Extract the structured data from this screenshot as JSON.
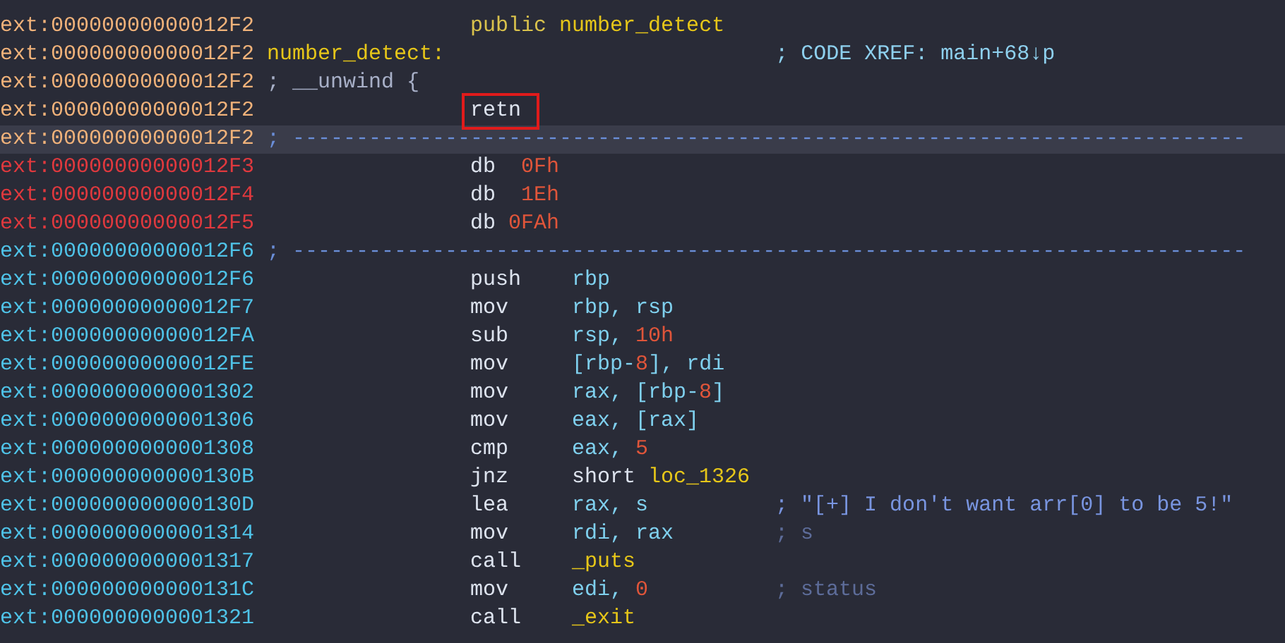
{
  "rows": [
    {
      "address": {
        "text": "ext:00000000000012F2",
        "color": "#f0b27a"
      },
      "kind": "directive",
      "selected": false,
      "tokens": [
        {
          "text": "public",
          "color": "#d9c24c"
        },
        {
          "text": "number_detect",
          "color": "#e6c619"
        }
      ]
    },
    {
      "address": {
        "text": "ext:00000000000012F2",
        "color": "#f0b27a"
      },
      "kind": "label",
      "selected": false,
      "label": "number_detect:",
      "comment": {
        "text": "; CODE XREF: main+68↓p",
        "color": "#8ed0ee"
      }
    },
    {
      "address": {
        "text": "ext:00000000000012F2",
        "color": "#f0b27a"
      },
      "kind": "note",
      "selected": false,
      "text": "; __unwind {"
    },
    {
      "address": {
        "text": "ext:00000000000012F2",
        "color": "#f0b27a"
      },
      "kind": "instruction",
      "selected": false,
      "mnemonic": "retn",
      "boxed": true,
      "tokens": []
    },
    {
      "address": {
        "text": "ext:00000000000012F2",
        "color": "#f0b27a"
      },
      "kind": "separator",
      "selected": true,
      "text": "; ---------------------------------------------------------------------------"
    },
    {
      "address": {
        "text": "ext:00000000000012F3",
        "color": "#e0393e"
      },
      "kind": "data",
      "selected": false,
      "mnemonic": "db",
      "value": "0Fh"
    },
    {
      "address": {
        "text": "ext:00000000000012F4",
        "color": "#e0393e"
      },
      "kind": "data",
      "selected": false,
      "mnemonic": "db",
      "value": "1Eh"
    },
    {
      "address": {
        "text": "ext:00000000000012F5",
        "color": "#e0393e"
      },
      "kind": "data",
      "selected": false,
      "mnemonic": "db",
      "value": "0FAh"
    },
    {
      "address": {
        "text": "ext:00000000000012F6",
        "color": "#4fc3e8"
      },
      "kind": "separator",
      "selected": false,
      "text": "; ---------------------------------------------------------------------------"
    },
    {
      "address": {
        "text": "ext:00000000000012F6",
        "color": "#4fc3e8"
      },
      "kind": "instruction",
      "selected": false,
      "mnemonic": "push",
      "boxed": false,
      "tokens": [
        {
          "text": "rbp",
          "color": "#7fd0ee"
        }
      ]
    },
    {
      "address": {
        "text": "ext:00000000000012F7",
        "color": "#4fc3e8"
      },
      "kind": "instruction",
      "selected": false,
      "mnemonic": "mov",
      "boxed": false,
      "tokens": [
        {
          "text": "rbp, rsp",
          "color": "#7fd0ee"
        }
      ]
    },
    {
      "address": {
        "text": "ext:00000000000012FA",
        "color": "#4fc3e8"
      },
      "kind": "instruction",
      "selected": false,
      "mnemonic": "sub",
      "boxed": false,
      "tokens": [
        {
          "text": "rsp,",
          "color": "#7fd0ee"
        },
        {
          "text": "10h",
          "color": "#e0553a"
        }
      ]
    },
    {
      "address": {
        "text": "ext:00000000000012FE",
        "color": "#4fc3e8"
      },
      "kind": "instruction",
      "selected": false,
      "mnemonic": "mov",
      "boxed": false,
      "tokens": [
        {
          "text": "[rbp-",
          "color": "#7fd0ee"
        },
        {
          "text": "8",
          "color": "#e0553a"
        },
        {
          "text": "], rdi",
          "color": "#7fd0ee"
        }
      ]
    },
    {
      "address": {
        "text": "ext:0000000000001302",
        "color": "#4fc3e8"
      },
      "kind": "instruction",
      "selected": false,
      "mnemonic": "mov",
      "boxed": false,
      "tokens": [
        {
          "text": "rax, [rbp-",
          "color": "#7fd0ee"
        },
        {
          "text": "8",
          "color": "#e0553a"
        },
        {
          "text": "]",
          "color": "#7fd0ee"
        }
      ]
    },
    {
      "address": {
        "text": "ext:0000000000001306",
        "color": "#4fc3e8"
      },
      "kind": "instruction",
      "selected": false,
      "mnemonic": "mov",
      "boxed": false,
      "tokens": [
        {
          "text": "eax, [rax]",
          "color": "#7fd0ee"
        }
      ]
    },
    {
      "address": {
        "text": "ext:0000000000001308",
        "color": "#4fc3e8"
      },
      "kind": "instruction",
      "selected": false,
      "mnemonic": "cmp",
      "boxed": false,
      "tokens": [
        {
          "text": "eax,",
          "color": "#7fd0ee"
        },
        {
          "text": "5",
          "color": "#e0553a"
        }
      ]
    },
    {
      "address": {
        "text": "ext:000000000000130B",
        "color": "#4fc3e8"
      },
      "kind": "instruction",
      "selected": false,
      "mnemonic": "jnz",
      "boxed": false,
      "tokens": [
        {
          "text": "short",
          "color": "#dde3ee"
        },
        {
          "text": "loc_1326",
          "color": "#e6c619"
        }
      ]
    },
    {
      "address": {
        "text": "ext:000000000000130D",
        "color": "#4fc3e8"
      },
      "kind": "instruction",
      "selected": false,
      "mnemonic": "lea",
      "boxed": false,
      "tokens": [
        {
          "text": "rax, s",
          "color": "#7fd0ee"
        }
      ],
      "comment": {
        "text": "; \"[+] I don't want arr[0] to be 5!\"",
        "color": "#7995e0"
      }
    },
    {
      "address": {
        "text": "ext:0000000000001314",
        "color": "#4fc3e8"
      },
      "kind": "instruction",
      "selected": false,
      "mnemonic": "mov",
      "boxed": false,
      "tokens": [
        {
          "text": "rdi, rax",
          "color": "#7fd0ee"
        }
      ],
      "comment": {
        "text": "; s",
        "color": "#5d6c99"
      }
    },
    {
      "address": {
        "text": "ext:0000000000001317",
        "color": "#4fc3e8"
      },
      "kind": "instruction",
      "selected": false,
      "mnemonic": "call",
      "boxed": false,
      "tokens": [
        {
          "text": "_puts",
          "color": "#e6c619"
        }
      ]
    },
    {
      "address": {
        "text": "ext:000000000000131C",
        "color": "#4fc3e8"
      },
      "kind": "instruction",
      "selected": false,
      "mnemonic": "mov",
      "boxed": false,
      "tokens": [
        {
          "text": "edi,",
          "color": "#7fd0ee"
        },
        {
          "text": "0",
          "color": "#e0553a"
        }
      ],
      "comment": {
        "text": "; status",
        "color": "#5d6c99"
      }
    },
    {
      "address": {
        "text": "ext:0000000000001321",
        "color": "#4fc3e8"
      },
      "kind": "instruction",
      "selected": false,
      "mnemonic": "call",
      "boxed": false,
      "tokens": [
        {
          "text": "_exit",
          "color": "#e6c619"
        }
      ]
    }
  ]
}
